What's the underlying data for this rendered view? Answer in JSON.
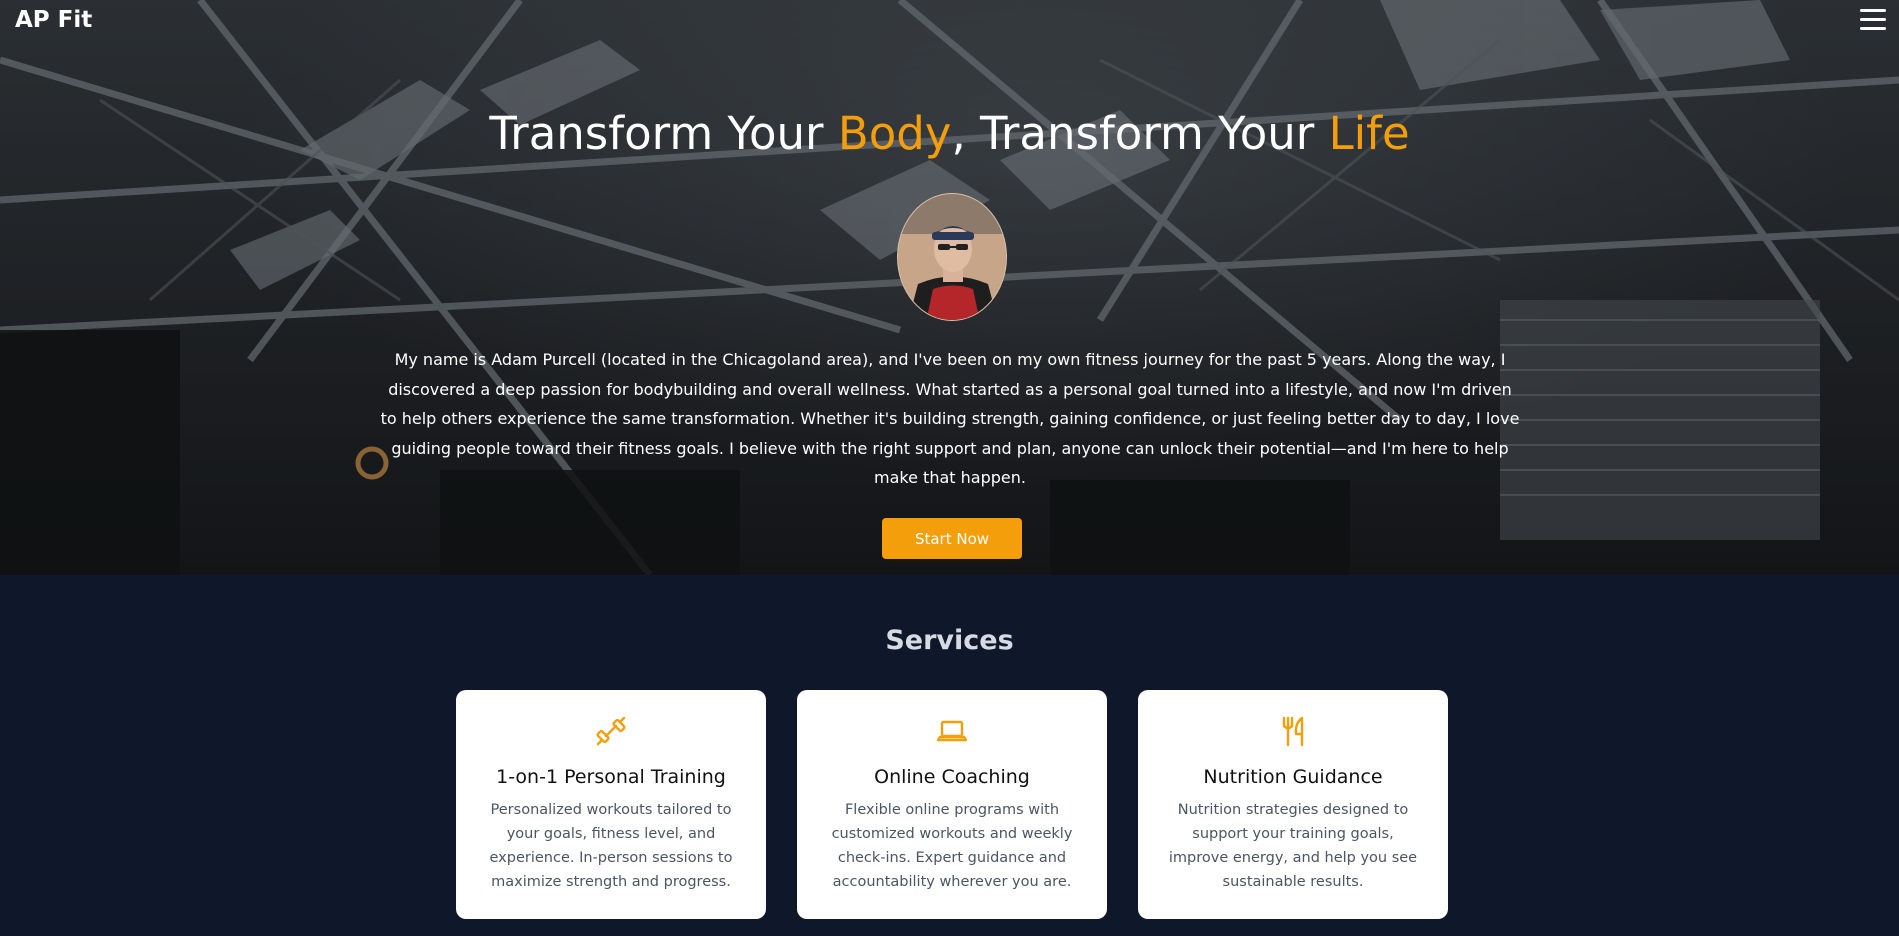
{
  "header": {
    "brand": "AP Fit",
    "menu_icon": "hamburger-menu-icon"
  },
  "hero": {
    "title_part1": "Transform Your ",
    "title_accent1": "Body",
    "title_part2": ", Transform Your ",
    "title_accent2": "Life",
    "bio": "My name is Adam Purcell (located in the Chicagoland area), and I've been on my own fitness journey for the past 5 years. Along the way, I discovered a deep passion for bodybuilding and overall wellness. What started as a personal goal turned into a lifestyle, and now I'm driven to help others experience the same transformation. Whether it's building strength, gaining confidence, or just feeling better day to day, I love guiding people toward their fitness goals. I believe with the right support and plan, anyone can unlock their potential—and I'm here to help make that happen.",
    "cta_label": "Start Now"
  },
  "services": {
    "title": "Services",
    "cards": [
      {
        "icon": "dumbbell-icon",
        "title": "1-on-1 Personal Training",
        "description": "Personalized workouts tailored to your goals, fitness level, and experience. In-person sessions to maximize strength and progress."
      },
      {
        "icon": "laptop-icon",
        "title": "Online Coaching",
        "description": "Flexible online programs with customized workouts and weekly check-ins. Expert guidance and accountability wherever you are."
      },
      {
        "icon": "utensils-icon",
        "title": "Nutrition Guidance",
        "description": "Nutrition strategies designed to support your training goals, improve energy, and help you see sustainable results."
      }
    ]
  },
  "colors": {
    "accent": "#f59e0b",
    "section_bg": "#0f172a",
    "card_bg": "#ffffff"
  }
}
